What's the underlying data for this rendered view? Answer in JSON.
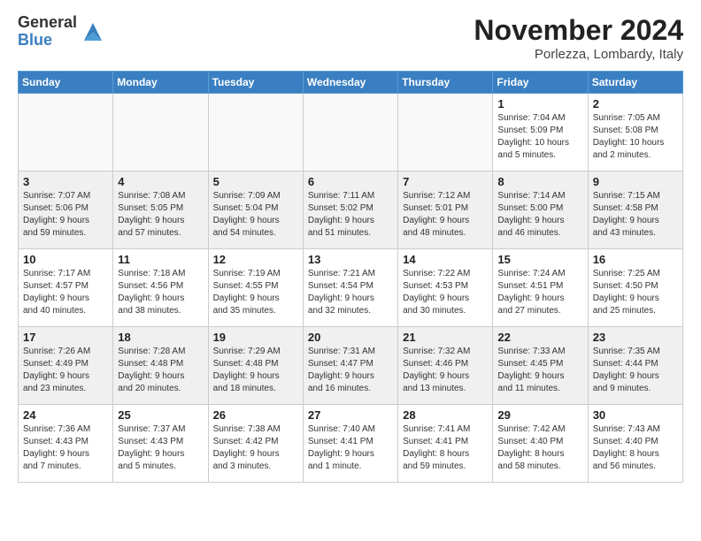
{
  "logo": {
    "general": "General",
    "blue": "Blue"
  },
  "title": "November 2024",
  "location": "Porlezza, Lombardy, Italy",
  "days_header": [
    "Sunday",
    "Monday",
    "Tuesday",
    "Wednesday",
    "Thursday",
    "Friday",
    "Saturday"
  ],
  "weeks": [
    [
      {
        "day": "",
        "info": "",
        "empty": true
      },
      {
        "day": "",
        "info": "",
        "empty": true
      },
      {
        "day": "",
        "info": "",
        "empty": true
      },
      {
        "day": "",
        "info": "",
        "empty": true
      },
      {
        "day": "",
        "info": "",
        "empty": true
      },
      {
        "day": "1",
        "info": "Sunrise: 7:04 AM\nSunset: 5:09 PM\nDaylight: 10 hours\nand 5 minutes."
      },
      {
        "day": "2",
        "info": "Sunrise: 7:05 AM\nSunset: 5:08 PM\nDaylight: 10 hours\nand 2 minutes."
      }
    ],
    [
      {
        "day": "3",
        "info": "Sunrise: 7:07 AM\nSunset: 5:06 PM\nDaylight: 9 hours\nand 59 minutes."
      },
      {
        "day": "4",
        "info": "Sunrise: 7:08 AM\nSunset: 5:05 PM\nDaylight: 9 hours\nand 57 minutes."
      },
      {
        "day": "5",
        "info": "Sunrise: 7:09 AM\nSunset: 5:04 PM\nDaylight: 9 hours\nand 54 minutes."
      },
      {
        "day": "6",
        "info": "Sunrise: 7:11 AM\nSunset: 5:02 PM\nDaylight: 9 hours\nand 51 minutes."
      },
      {
        "day": "7",
        "info": "Sunrise: 7:12 AM\nSunset: 5:01 PM\nDaylight: 9 hours\nand 48 minutes."
      },
      {
        "day": "8",
        "info": "Sunrise: 7:14 AM\nSunset: 5:00 PM\nDaylight: 9 hours\nand 46 minutes."
      },
      {
        "day": "9",
        "info": "Sunrise: 7:15 AM\nSunset: 4:58 PM\nDaylight: 9 hours\nand 43 minutes."
      }
    ],
    [
      {
        "day": "10",
        "info": "Sunrise: 7:17 AM\nSunset: 4:57 PM\nDaylight: 9 hours\nand 40 minutes."
      },
      {
        "day": "11",
        "info": "Sunrise: 7:18 AM\nSunset: 4:56 PM\nDaylight: 9 hours\nand 38 minutes."
      },
      {
        "day": "12",
        "info": "Sunrise: 7:19 AM\nSunset: 4:55 PM\nDaylight: 9 hours\nand 35 minutes."
      },
      {
        "day": "13",
        "info": "Sunrise: 7:21 AM\nSunset: 4:54 PM\nDaylight: 9 hours\nand 32 minutes."
      },
      {
        "day": "14",
        "info": "Sunrise: 7:22 AM\nSunset: 4:53 PM\nDaylight: 9 hours\nand 30 minutes."
      },
      {
        "day": "15",
        "info": "Sunrise: 7:24 AM\nSunset: 4:51 PM\nDaylight: 9 hours\nand 27 minutes."
      },
      {
        "day": "16",
        "info": "Sunrise: 7:25 AM\nSunset: 4:50 PM\nDaylight: 9 hours\nand 25 minutes."
      }
    ],
    [
      {
        "day": "17",
        "info": "Sunrise: 7:26 AM\nSunset: 4:49 PM\nDaylight: 9 hours\nand 23 minutes."
      },
      {
        "day": "18",
        "info": "Sunrise: 7:28 AM\nSunset: 4:48 PM\nDaylight: 9 hours\nand 20 minutes."
      },
      {
        "day": "19",
        "info": "Sunrise: 7:29 AM\nSunset: 4:48 PM\nDaylight: 9 hours\nand 18 minutes."
      },
      {
        "day": "20",
        "info": "Sunrise: 7:31 AM\nSunset: 4:47 PM\nDaylight: 9 hours\nand 16 minutes."
      },
      {
        "day": "21",
        "info": "Sunrise: 7:32 AM\nSunset: 4:46 PM\nDaylight: 9 hours\nand 13 minutes."
      },
      {
        "day": "22",
        "info": "Sunrise: 7:33 AM\nSunset: 4:45 PM\nDaylight: 9 hours\nand 11 minutes."
      },
      {
        "day": "23",
        "info": "Sunrise: 7:35 AM\nSunset: 4:44 PM\nDaylight: 9 hours\nand 9 minutes."
      }
    ],
    [
      {
        "day": "24",
        "info": "Sunrise: 7:36 AM\nSunset: 4:43 PM\nDaylight: 9 hours\nand 7 minutes."
      },
      {
        "day": "25",
        "info": "Sunrise: 7:37 AM\nSunset: 4:43 PM\nDaylight: 9 hours\nand 5 minutes."
      },
      {
        "day": "26",
        "info": "Sunrise: 7:38 AM\nSunset: 4:42 PM\nDaylight: 9 hours\nand 3 minutes."
      },
      {
        "day": "27",
        "info": "Sunrise: 7:40 AM\nSunset: 4:41 PM\nDaylight: 9 hours\nand 1 minute."
      },
      {
        "day": "28",
        "info": "Sunrise: 7:41 AM\nSunset: 4:41 PM\nDaylight: 8 hours\nand 59 minutes."
      },
      {
        "day": "29",
        "info": "Sunrise: 7:42 AM\nSunset: 4:40 PM\nDaylight: 8 hours\nand 58 minutes."
      },
      {
        "day": "30",
        "info": "Sunrise: 7:43 AM\nSunset: 4:40 PM\nDaylight: 8 hours\nand 56 minutes."
      }
    ]
  ]
}
